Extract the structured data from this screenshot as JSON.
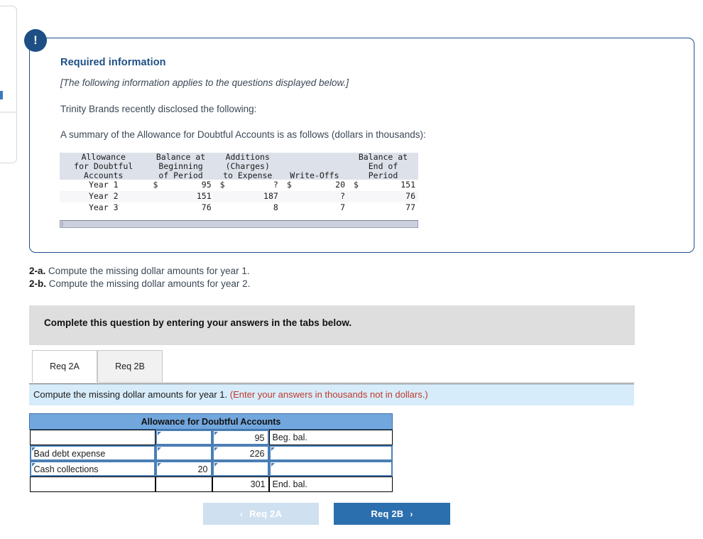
{
  "alert": {
    "icon": "exclamation-icon",
    "glyph": "!"
  },
  "required_info": {
    "title": "Required information",
    "italic_note": "[The following information applies to the questions displayed below.]",
    "line1": "Trinity Brands recently disclosed the following:",
    "line2": "A summary of the Allowance for Doubtful Accounts is as follows (dollars in thousands):"
  },
  "summary_table": {
    "headers": {
      "col1": [
        "Allowance",
        "for Doubtful",
        "Accounts"
      ],
      "col2": [
        "Balance at",
        "Beginning",
        "of Period"
      ],
      "col3": [
        "Additions",
        "(Charges)",
        "to Expense"
      ],
      "col4": [
        "",
        "",
        "Write-Offs"
      ],
      "col5": [
        "Balance at",
        "End of",
        "Period"
      ]
    },
    "rows": [
      {
        "label": "Year 1",
        "beginning": "95",
        "additions": "?",
        "writeoffs": "20",
        "ending": "151",
        "dollar": true
      },
      {
        "label": "Year 2",
        "beginning": "151",
        "additions": "187",
        "writeoffs": "?",
        "ending": "76",
        "dollar": false
      },
      {
        "label": "Year 3",
        "beginning": "76",
        "additions": "8",
        "writeoffs": "7",
        "ending": "77",
        "dollar": false
      }
    ],
    "dollar_sign": "$"
  },
  "requirements": {
    "a_number": "2-a.",
    "a_text": "Compute the missing dollar amounts for year 1.",
    "b_number": "2-b.",
    "b_text": "Compute the missing dollar amounts for year 2."
  },
  "complete_banner": "Complete this question by entering your answers in the tabs below.",
  "tabs": [
    {
      "label": "Req 2A",
      "active": true
    },
    {
      "label": "Req 2B",
      "active": false
    }
  ],
  "instruction": {
    "main": "Compute the missing dollar amounts for year 1. ",
    "red": "(Enter your answers in thousands not in dollars.)"
  },
  "taccount": {
    "title": "Allowance for Doubtful Accounts",
    "rows": [
      {
        "desc": "",
        "debit": "",
        "credit": "95",
        "note": "Beg. bal.",
        "desc_editable": false,
        "debit_editable": true,
        "credit_editable": true,
        "note_editable": false
      },
      {
        "desc": "Bad debt expense",
        "debit": "",
        "credit": "226",
        "note": "",
        "desc_editable": true,
        "debit_editable": true,
        "credit_editable": true,
        "note_editable": true
      },
      {
        "desc": "Cash collections",
        "debit": "20",
        "credit": "",
        "note": "",
        "desc_editable": true,
        "debit_editable": true,
        "credit_editable": true,
        "note_editable": true
      },
      {
        "desc": "",
        "debit": "",
        "credit": "301",
        "note": "End. bal.",
        "desc_editable": false,
        "debit_editable": false,
        "credit_editable": false,
        "note_editable": false
      }
    ]
  },
  "nav": {
    "prev_label": "Req 2A",
    "prev_chevron": "‹",
    "next_label": "Req 2B",
    "next_chevron": "›"
  },
  "colors": {
    "card_border": "#1c4f86",
    "badge": "#1d4f85",
    "table_header": "#dde1ea",
    "taccount_header": "#72a7dd",
    "blue_banner": "#d7ecfa",
    "gray_banner": "#dedede",
    "red_text": "#c0392b",
    "next_button": "#2c6fae",
    "prev_button": "#cfe0f0"
  }
}
